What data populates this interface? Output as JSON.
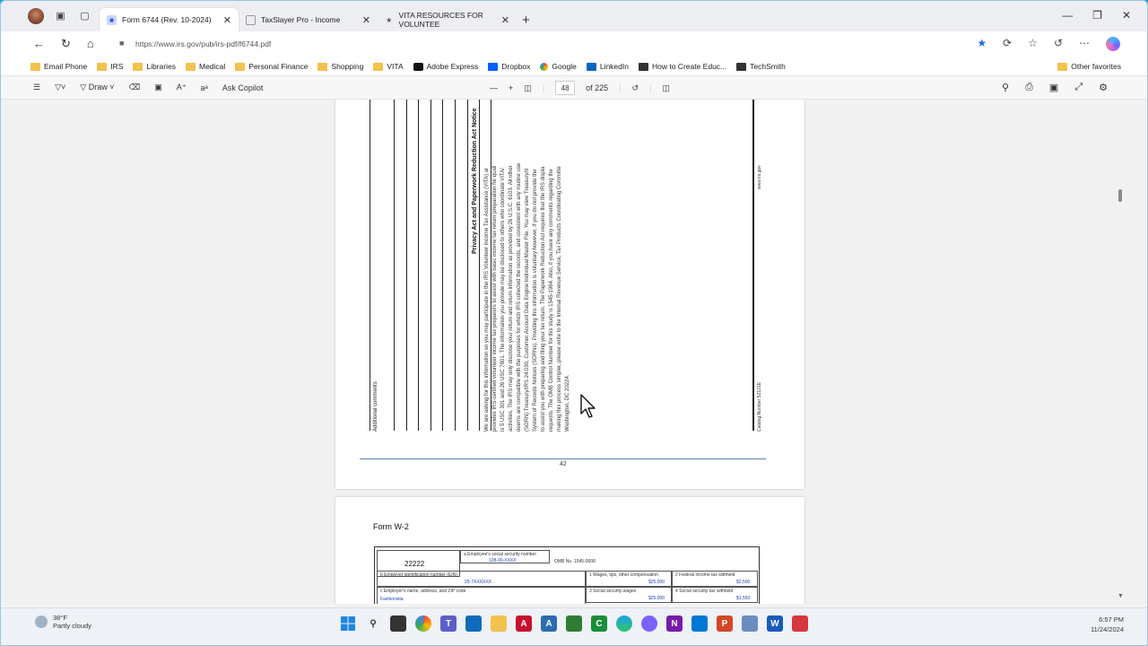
{
  "tabs": [
    {
      "label": "Form 6744 (Rev. 10-2024)",
      "active": true
    },
    {
      "label": "TaxSlayer Pro - Income",
      "active": false
    },
    {
      "label": "VITA RESOURCES FOR VOLUNTEE",
      "active": false
    }
  ],
  "address": {
    "url": "https://www.irs.gov/pub/irs-pdf/f6744.pdf"
  },
  "favorites": {
    "items": [
      "Email Phone",
      "IRS",
      "Libraries",
      "Medical",
      "Personal Finance",
      "Shopping",
      "VITA",
      "Adobe Express",
      "Dropbox",
      "Google",
      "LinkedIn",
      "How to Create Educ...",
      "TechSmith"
    ],
    "other": "Other favorites"
  },
  "pdf_toolbar": {
    "draw_label": "Draw",
    "copilot_label": "Ask Copilot",
    "current_page": "48",
    "total_pages": "of 225"
  },
  "page1": {
    "side_label": "Additional comments",
    "privacy_title": "Privacy Act and Paperwork Reduction Act Notice",
    "privacy_lines": [
      "We are asking for this information so you may participate in the IRS Volunteer Income Tax Assistance (VITA) ar",
      "provides IRS-certified volunteer income tax preparers to assist with basic income tax return preparation for quali",
      "is 5 USC 301 and 26 USC 7801. The information you provide may be disclosed to others who coordinate VITA/",
      "activities. The IRS may only disclose your return and return information as provided by 26 U.S.C. 6103. All other",
      "deems are compatible with the purposes for which IRS collected the records, and consistent with any routine use",
      "(SORN) Treasury/IRS 24.030, Customer Account Data Engine Individual Master File. You may view Treasury/II",
      "System of Records Notices (SORNs). Providing this information is voluntary however, if you do not provide the",
      "to assist you with preparing and filing your tax return. The Paperwork Reduction Act requires that the IRS displa",
      "requests. The OMB Control Number for this study is 1545-1964. Also, if you have any comments regarding the",
      "making this process simpler, please write to the Internal Revenue Service, Tax Products Coordinating Committe",
      "Washington, DC 20224."
    ],
    "catalog": "Catalog Number 52121E",
    "website": "www.irs.gov",
    "page_number": "42"
  },
  "page2": {
    "title": "Form W-2",
    "code": "22222",
    "a_label": "a Employee's social security number",
    "a_value": "128-00-XXXX",
    "omb": "OMB No. 1545-0008",
    "b_label": "b Employer identification number (EIN)",
    "b_value": "25-7XXXXXX",
    "c_label": "c Employer's name, address, and ZIP code",
    "c_value": "Fashionista",
    "box1_label": "1 Wages, tips, other compensation",
    "box1_value": "$25,000",
    "box2_label": "2 Federal income tax withheld",
    "box2_value": "$2,500",
    "box3_label": "3 Social security wages",
    "box3_value": "$25,000",
    "box4_label": "4 Social security tax withheld",
    "box4_value": "$1,550"
  },
  "taskbar": {
    "temp": "38°F",
    "weather": "Partly cloudy",
    "time": "6:57 PM",
    "date": "11/24/2024"
  }
}
